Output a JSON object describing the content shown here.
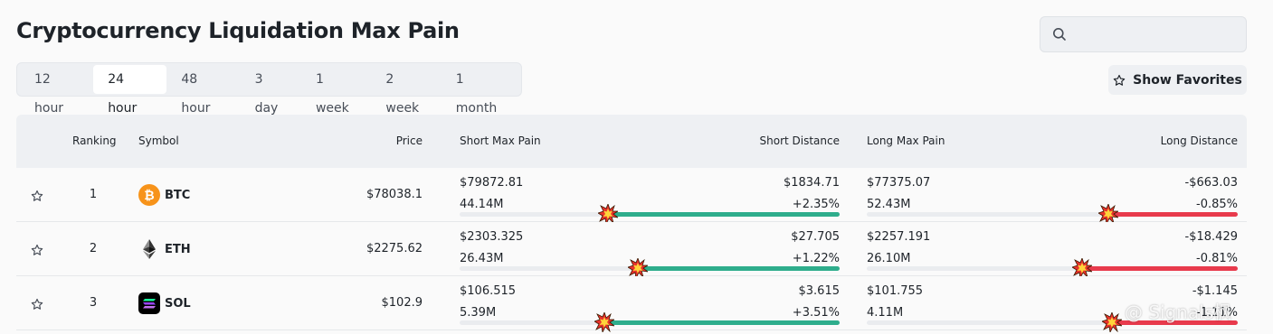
{
  "page": {
    "title": "Cryptocurrency Liquidation Max Pain"
  },
  "search": {
    "placeholder": ""
  },
  "tabs": [
    {
      "label": "12 hour",
      "active": false
    },
    {
      "label": "24 hour",
      "active": true
    },
    {
      "label": "48 hour",
      "active": false
    },
    {
      "label": "3 day",
      "active": false
    },
    {
      "label": "1 week",
      "active": false
    },
    {
      "label": "2 week",
      "active": false
    },
    {
      "label": "1 month",
      "active": false
    }
  ],
  "favorites_button": {
    "label": "Show Favorites"
  },
  "table": {
    "headers": {
      "ranking": "Ranking",
      "symbol": "Symbol",
      "price": "Price",
      "short_max_pain": "Short Max Pain",
      "short_distance": "Short Distance",
      "long_max_pain": "Long Max Pain",
      "long_distance": "Long Distance"
    },
    "rows": [
      {
        "rank": "1",
        "symbol": "BTC",
        "icon": "bitcoin-icon",
        "icon_color": "#f7931a",
        "price": "$78038.1",
        "short_price": "$79872.81",
        "short_volume": "44.14M",
        "short_distance": "$1834.71",
        "short_percent": "+2.35%",
        "long_price": "$77375.07",
        "long_volume": "52.43M",
        "long_distance": "-$663.03",
        "long_percent": "-0.85%",
        "short_fill": 0.61,
        "long_fill": 0.35
      },
      {
        "rank": "2",
        "symbol": "ETH",
        "icon": "ethereum-icon",
        "icon_color": "#3c3c3d",
        "price": "$2275.62",
        "short_price": "$2303.325",
        "short_volume": "26.43M",
        "short_distance": "$27.705",
        "short_percent": "+1.22%",
        "long_price": "$2257.191",
        "long_volume": "26.10M",
        "long_distance": "-$18.429",
        "long_percent": "-0.81%",
        "short_fill": 0.53,
        "long_fill": 0.42
      },
      {
        "rank": "3",
        "symbol": "SOL",
        "icon": "solana-icon",
        "icon_color": "#14f195",
        "price": "$102.9",
        "short_price": "$106.515",
        "short_volume": "5.39M",
        "short_distance": "$3.615",
        "short_percent": "+3.51%",
        "long_price": "$101.755",
        "long_volume": "4.11M",
        "long_distance": "-$1.145",
        "long_percent": "-1.11%",
        "short_fill": 0.62,
        "long_fill": 0.34
      }
    ]
  },
  "watermark": {
    "text": "@ Signals枫"
  },
  "colors": {
    "positive": "#2ebd85",
    "negative": "#f6465d",
    "accent_fill_green": "#2ead8c",
    "accent_fill_red": "#e83a4c"
  }
}
